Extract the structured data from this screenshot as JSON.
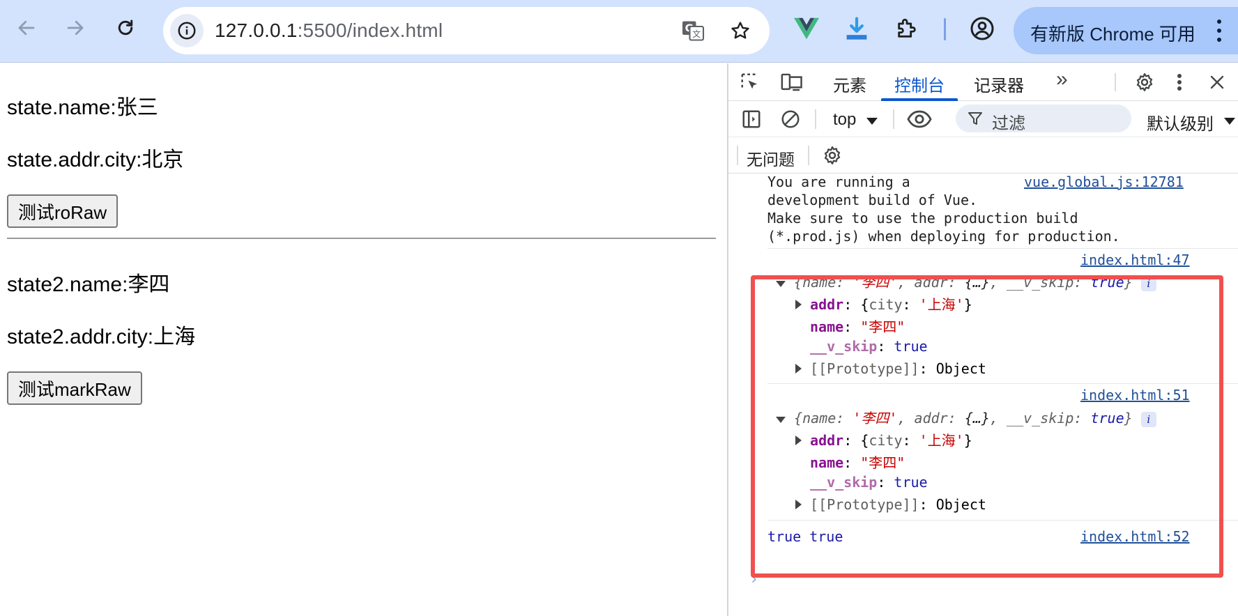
{
  "browser": {
    "url_host": "127.0.0.1",
    "url_rest": ":5500/index.html",
    "update_label": "有新版 Chrome 可用",
    "icons": [
      "back-icon",
      "forward-icon",
      "reload-icon",
      "site-info-icon",
      "translate-icon",
      "bookmark-star-icon",
      "vue-devtools-icon",
      "download-extension-icon",
      "extensions-puzzle-icon",
      "profile-icon",
      "more-vert-icon"
    ]
  },
  "page": {
    "state_name": "state.name:张三",
    "state_city": "state.addr.city:北京",
    "btn_toraw": "测试roRaw",
    "state2_name": "state2.name:李四",
    "state2_city": "state2.addr.city:上海",
    "btn_markraw": "测试markRaw"
  },
  "devtools": {
    "tabs": {
      "elements": "元素",
      "console": "控制台",
      "recorder": "记录器",
      "more": "»"
    },
    "context": "top",
    "filter_placeholder": "过滤",
    "level": "默认级别",
    "issues": "无问题",
    "console": {
      "warn": {
        "line1": "You are running a",
        "line2": "development build of Vue.",
        "line3": "Make sure to use the production build",
        "line4": "(*.prod.js) when deploying for production.",
        "source": "vue.global.js:12781"
      },
      "log1": {
        "source": "index.html:47",
        "summary_open": "{",
        "k_name": "name",
        "v_name": "'李四'",
        "k_addr": "addr",
        "v_addr": "{…}",
        "k_skip": "__v_skip",
        "v_skip": "true",
        "summary_close": "}",
        "info": "i",
        "addr_key": "addr",
        "addr_preview_open": "{",
        "addr_city_key": "city",
        "addr_city_val": "'上海'",
        "addr_preview_close": "}",
        "name_key": "name",
        "name_val": "\"李四\"",
        "skip_key": "__v_skip",
        "skip_val": "true",
        "proto_key": "[[Prototype]]",
        "proto_val": "Object"
      },
      "log2": {
        "source": "index.html:51",
        "summary_open": "{",
        "k_name": "name",
        "v_name": "'李四'",
        "k_addr": "addr",
        "v_addr": "{…}",
        "k_skip": "__v_skip",
        "v_skip": "true",
        "summary_close": "}",
        "info": "i",
        "addr_key": "addr",
        "addr_preview_open": "{",
        "addr_city_key": "city",
        "addr_city_val": "'上海'",
        "addr_preview_close": "}",
        "name_key": "name",
        "name_val": "\"李四\"",
        "skip_key": "__v_skip",
        "skip_val": "true",
        "proto_key": "[[Prototype]]",
        "proto_val": "Object"
      },
      "log3": {
        "text": "true true",
        "source": "index.html:52"
      },
      "prompt": "›"
    }
  },
  "colors": {
    "toolbar_bg": "#d3e3fd",
    "update_btn": "#a8c7fa",
    "devtools_accent": "#0b57d0",
    "highlight_border": "#f0504f",
    "console_key": "#881391",
    "console_string": "#c80000",
    "console_keyword": "#1a1aa6"
  }
}
